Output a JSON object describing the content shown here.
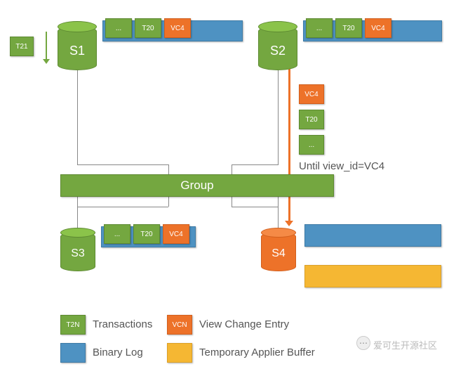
{
  "servers": {
    "s1": "S1",
    "s2": "S2",
    "s3": "S3",
    "s4": "S4"
  },
  "incoming_tx": "T21",
  "binlog_top": {
    "dots": "...",
    "t20": "T20",
    "vc4": "VC4"
  },
  "vertical_queue": {
    "vc4": "VC4",
    "t20": "T20",
    "dots": "..."
  },
  "group_label": "Group",
  "binlog_s3": {
    "dots": "...",
    "t20": "T20",
    "vc4": "VC4"
  },
  "annotation": "Until view_id=VC4",
  "legend": {
    "t2n": "T2N",
    "transactions": "Transactions",
    "vcn": "VCN",
    "view_change": "View Change Entry",
    "binary_log": "Binary Log",
    "tab": "Temporary Applier Buffer"
  },
  "watermark": "爱可生开源社区"
}
